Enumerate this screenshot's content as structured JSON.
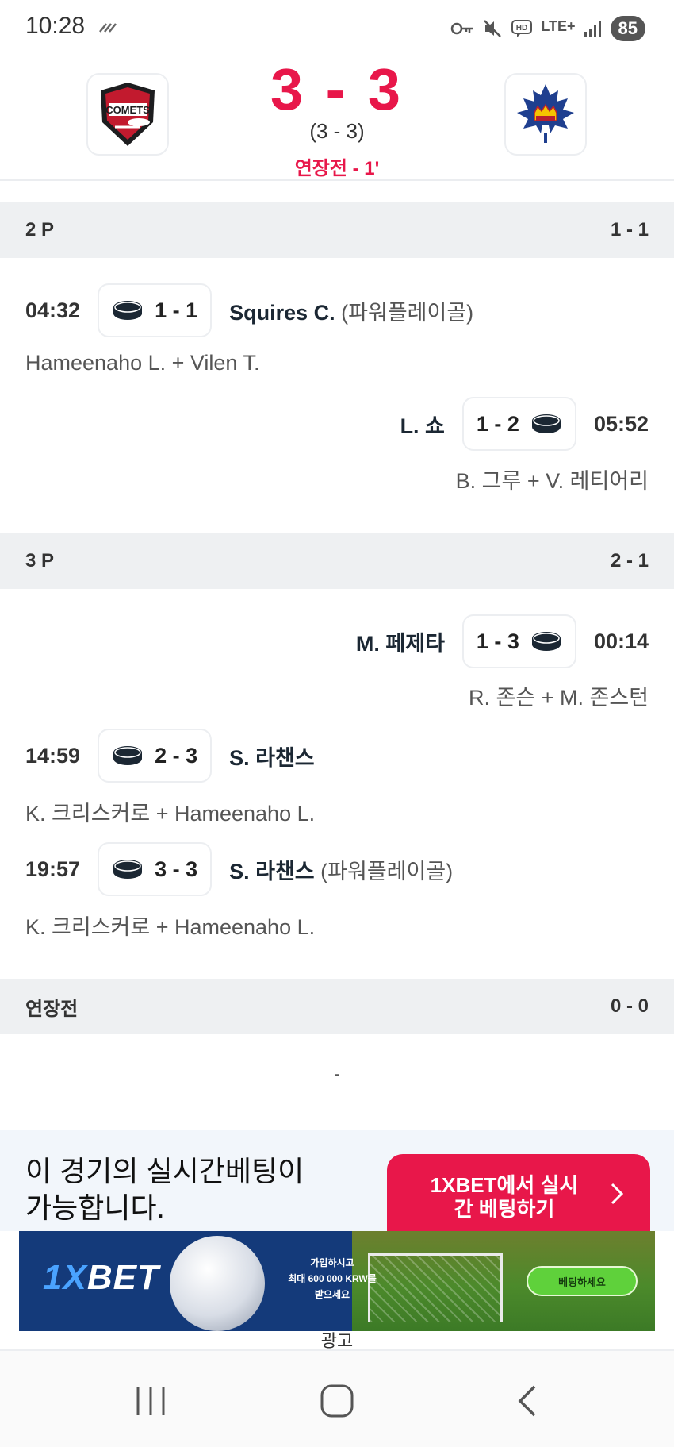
{
  "status_bar": {
    "time": "10:28",
    "network": "LTE+",
    "battery": "85",
    "icons": [
      "key-icon",
      "mute-icon",
      "hd-icon",
      "lte-icon",
      "signal-icon",
      "battery-icon"
    ]
  },
  "match": {
    "score": "3 - 3",
    "regulation_score": "(3  -  3)",
    "status": "연장전 - 1'",
    "home_logo_text": "COMETS",
    "accent_color": "#e8174a"
  },
  "periods": [
    {
      "label": "2 P",
      "score": "1 - 1",
      "events": [
        {
          "time": "04:32",
          "score": "1 - 1",
          "player": "Squires C.",
          "note": "(파워플레이골)",
          "assist": "Hameenaho L. + Vilen T.",
          "side": "home"
        },
        {
          "time": "05:52",
          "score": "1 - 2",
          "player": "L. 쇼",
          "note": "",
          "assist": "B. 그루 + V. 레티어리",
          "side": "away"
        }
      ]
    },
    {
      "label": "3 P",
      "score": "2 - 1",
      "events": [
        {
          "time": "00:14",
          "score": "1 - 3",
          "player": "M. 페제타",
          "note": "",
          "assist": "R. 존슨 + M. 존스턴",
          "side": "away"
        },
        {
          "time": "14:59",
          "score": "2 - 3",
          "player": "S. 라챈스",
          "note": "",
          "assist": "K. 크리스커로 + Hameenaho L.",
          "side": "home"
        },
        {
          "time": "19:57",
          "score": "3 - 3",
          "player": "S. 라챈스",
          "note": "(파워플레이골)",
          "assist": "K. 크리스커로 + Hameenaho L.",
          "side": "home"
        }
      ]
    },
    {
      "label": "연장전",
      "score": "0 - 0",
      "empty_text": "-"
    }
  ],
  "promo": {
    "text_line1": "이 경기의 실시간베팅이",
    "text_line2": "가능합니다.",
    "button_line1": "1XBET에서 실시",
    "button_line2": "간 베팅하기"
  },
  "ad": {
    "logo_prefix": "1X",
    "logo_suffix": "BET",
    "copy_line1": "가입하시고",
    "copy_line2": "최대 600 000 KRW를",
    "copy_line3": "받으세요",
    "cta": "베팅하세요",
    "label": "광고"
  }
}
